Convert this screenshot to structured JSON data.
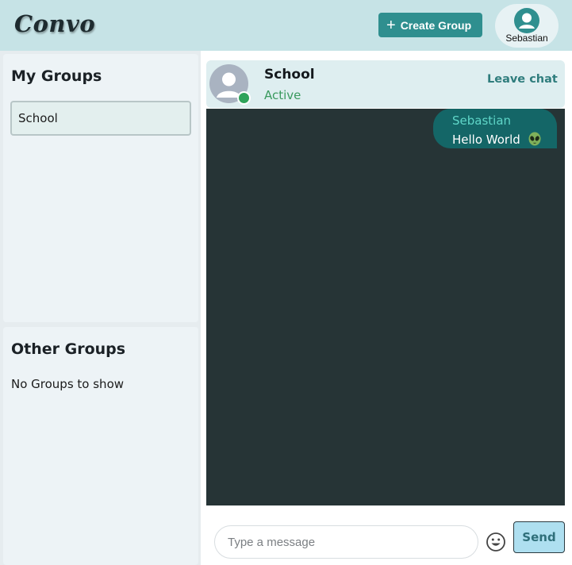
{
  "app": {
    "logo": "Convo"
  },
  "header": {
    "create_group_label": "Create Group",
    "user": {
      "name": "Sebastian"
    }
  },
  "sidebar": {
    "my_groups": {
      "title": "My Groups",
      "items": [
        {
          "label": "School"
        }
      ]
    },
    "other_groups": {
      "title": "Other Groups",
      "empty_text": "No Groups to show"
    }
  },
  "chat": {
    "name": "School",
    "status": "Active",
    "leave_label": "Leave chat",
    "messages": [
      {
        "sender": "Sebastian",
        "text": "Hello World",
        "emoji": "alien-icon"
      }
    ]
  },
  "composer": {
    "placeholder": "Type a message",
    "send_label": "Send"
  },
  "colors": {
    "topbar": "#c6e3e6",
    "accent": "#2f8f8f",
    "chat_bg": "#263436",
    "bubble": "#146667",
    "online": "#2fa35a",
    "send_button": "#aedff0"
  }
}
